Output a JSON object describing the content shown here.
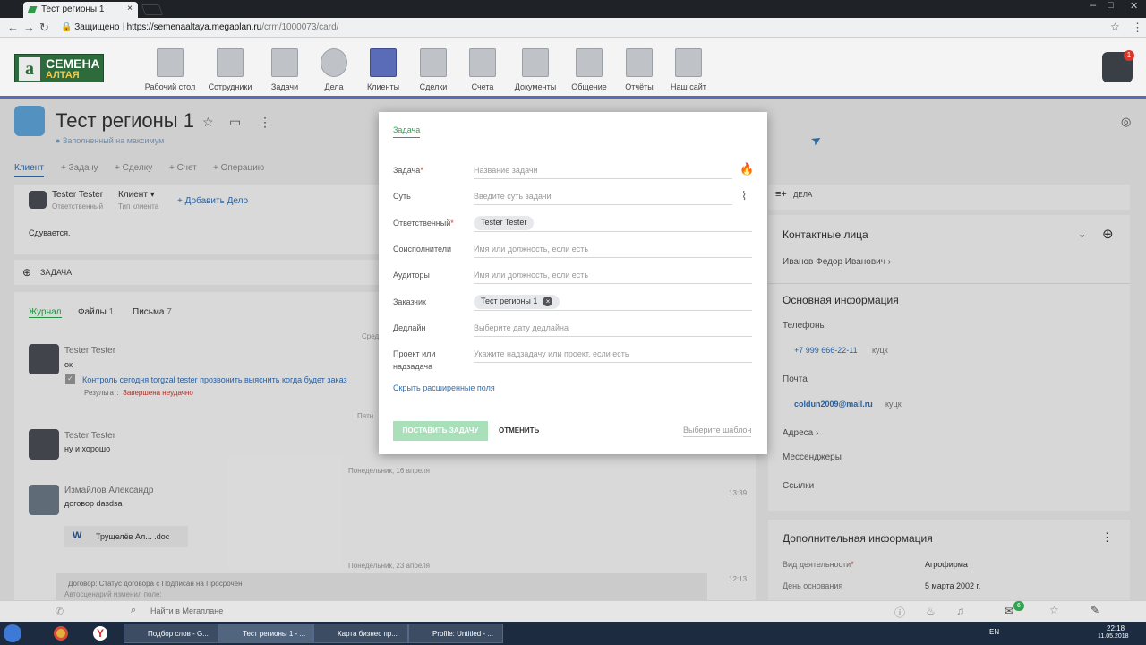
{
  "browser": {
    "tab_title": "Тест регионы 1",
    "tab_close": "×",
    "secure_label": "Защищено",
    "url_host": "https://semenaaltaya.megaplan.ru",
    "url_path": "/crm/1000073/card/",
    "win_min": "–",
    "win_max": "□",
    "win_close": "✕"
  },
  "header": {
    "logo_text": "СЕМЕНА",
    "logo_sub": "АЛТАЯ",
    "logo_mark": "a",
    "notification_count": "1",
    "nav": [
      {
        "label": "Рабочий стол",
        "icon": "desktop-icon"
      },
      {
        "label": "Сотрудники",
        "icon": "employees-icon"
      },
      {
        "label": "Задачи",
        "icon": "tasks-icon"
      },
      {
        "label": "Дела",
        "icon": "clock-icon"
      },
      {
        "label": "Клиенты",
        "icon": "clients-icon"
      },
      {
        "label": "Сделки",
        "icon": "briefcase-icon"
      },
      {
        "label": "Счета",
        "icon": "invoice-icon"
      },
      {
        "label": "Документы",
        "icon": "documents-icon"
      },
      {
        "label": "Общение",
        "icon": "chat-icon"
      },
      {
        "label": "Отчёты",
        "icon": "reports-icon"
      },
      {
        "label": "Наш сайт",
        "icon": "site-icon"
      }
    ]
  },
  "card": {
    "title": "Тест регионы 1",
    "subtitle": "● Заполненный на максимум",
    "tabs": [
      "Клиент",
      "+ Задачу",
      "+ Сделку",
      "+ Счет",
      "+ Операцию"
    ],
    "responsible_name": "Tester Tester",
    "responsible_role": "Ответственный",
    "client_type": "Клиент",
    "client_type_label": "Тип клиента",
    "add_deal": "+ Добавить Дело",
    "note": "Сдувается.",
    "task_label": "ЗАДАЧА"
  },
  "feed": {
    "tabs": [
      {
        "label": "Журнал",
        "count": ""
      },
      {
        "label": "Файлы",
        "count": "1"
      },
      {
        "label": "Письма",
        "count": "7"
      }
    ],
    "day1": "Сред",
    "day2": "Пятн",
    "day3": "Понедельник, 16 апреля",
    "day4": "Понедельник, 23 апреля",
    "entries": [
      {
        "author": "Tester Tester",
        "text": "ок",
        "task": "Контроль сегодня torgzal tester прозвонить выяснить когда будет заказ",
        "result_label": "Результат:",
        "result": "Завершена неудачно"
      },
      {
        "author": "Tester Tester",
        "text": "ну и хорошо"
      },
      {
        "author": "Измайлов Александр",
        "text": "договор dasdsa",
        "time": "13:39",
        "file": "Трущелёв Ал... .doc"
      }
    ],
    "contract_text": "Договор: Статус договора  с Подписан на Просрочен",
    "contract_sub": "Автосценарий изменил поле:",
    "contract_time": "12:13"
  },
  "right": {
    "deals_label": "ДЕЛА",
    "contacts_title": "Контактные лица",
    "contact_name": "Иванов Федор Иванович",
    "main_info_title": "Основная информация",
    "phones_label": "Телефоны",
    "phone": "+7 999 666-22-11",
    "phone_tag": "куцк",
    "email_label": "Почта",
    "email": "coldun2009@mail.ru",
    "email_tag": "куцк",
    "address_label": "Адреса",
    "messengers_label": "Мессенджеры",
    "links_label": "Ссылки",
    "extra_title": "Дополнительная информация",
    "activity_label": "Вид деятельности",
    "activity_value": "Агрофирма",
    "founded_label": "День основания",
    "founded_value": "5 марта 2002 г."
  },
  "modal": {
    "tab": "Задача",
    "fields": {
      "task_label": "Задача",
      "task_placeholder": "Название задачи",
      "essence_label": "Суть",
      "essence_placeholder": "Введите суть задачи",
      "responsible_label": "Ответственный",
      "responsible_value": "Tester Tester",
      "coexec_label": "Соисполнители",
      "coexec_placeholder": "Имя или должность, если есть",
      "auditors_label": "Аудиторы",
      "auditors_placeholder": "Имя или должность, если есть",
      "customer_label": "Заказчик",
      "customer_value": "Тест регионы 1",
      "deadline_label": "Дедлайн",
      "deadline_placeholder": "Выберите дату дедлайна",
      "project_label_1": "Проект или",
      "project_label_2": "надзадача",
      "project_placeholder": "Укажите надзадачу или проект, если есть"
    },
    "hide_fields": "Скрыть расширенные поля",
    "submit": "ПОСТАВИТЬ ЗАДАЧУ",
    "cancel": "ОТМЕНИТЬ",
    "template": "Выберите шаблон"
  },
  "bottom": {
    "search_placeholder": "Найти в Мегаплане",
    "chat_badge": "6"
  },
  "taskbar": {
    "items": [
      "Подбор слов - G...",
      "Тест регионы 1 - ...",
      "Карта бизнес пр...",
      "Profile: Untitled - ..."
    ],
    "lang": "EN",
    "time": "22:18",
    "date": "11.05.2018"
  },
  "colors": {
    "accent": "#2ea44f",
    "brand": "#5a6bb8",
    "link": "#2e6eb5"
  }
}
